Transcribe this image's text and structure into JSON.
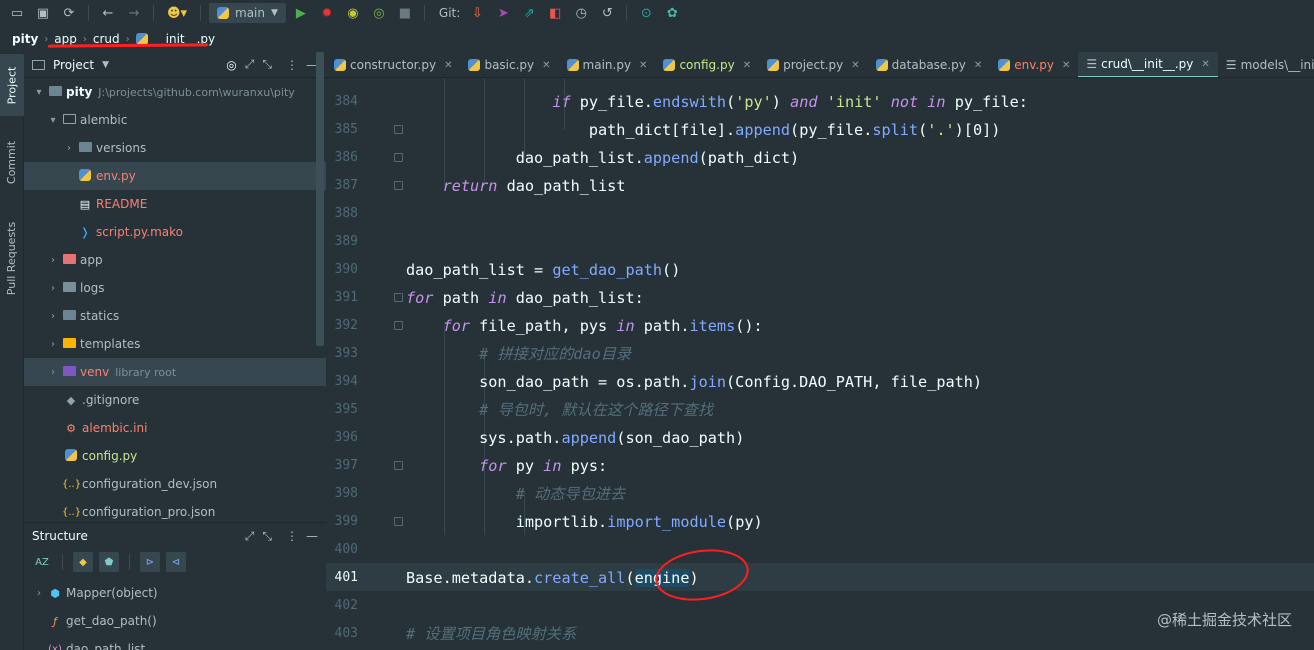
{
  "toolbar": {
    "branch": "main",
    "git_label": "Git:"
  },
  "navbar": {
    "items": [
      "pity",
      "app",
      "crud",
      "__init__.py"
    ]
  },
  "left_tabs": [
    "Project",
    "Commit",
    "Pull Requests"
  ],
  "project_panel": {
    "title": "Project",
    "tree": [
      {
        "label": "pity",
        "hint": "J:\\projects\\github.com\\wuranxu\\pity",
        "kind": "root"
      },
      {
        "label": "alembic",
        "kind": "folder"
      },
      {
        "label": "versions",
        "kind": "folder"
      },
      {
        "label": "env.py",
        "kind": "py"
      },
      {
        "label": "README",
        "kind": "text"
      },
      {
        "label": "script.py.mako",
        "kind": "mako"
      },
      {
        "label": "app",
        "kind": "folder"
      },
      {
        "label": "logs",
        "kind": "folder"
      },
      {
        "label": "statics",
        "kind": "folder"
      },
      {
        "label": "templates",
        "kind": "folder"
      },
      {
        "label": "venv",
        "hint": "library root",
        "kind": "venv"
      },
      {
        "label": ".gitignore",
        "kind": "git"
      },
      {
        "label": "alembic.ini",
        "kind": "ini"
      },
      {
        "label": "config.py",
        "kind": "py"
      },
      {
        "label": "configuration_dev.json",
        "kind": "json"
      },
      {
        "label": "configuration_pro.json",
        "kind": "json"
      }
    ]
  },
  "structure_panel": {
    "title": "Structure",
    "items": [
      {
        "label": "Mapper(object)",
        "icon": "class-icon"
      },
      {
        "label": "get_dao_path()",
        "icon": "function-icon"
      },
      {
        "label": "dao_path_list",
        "icon": "variable-icon"
      }
    ]
  },
  "tabs": [
    {
      "label": "constructor.py"
    },
    {
      "label": "basic.py"
    },
    {
      "label": "main.py"
    },
    {
      "label": "config.py"
    },
    {
      "label": "project.py"
    },
    {
      "label": "database.py"
    },
    {
      "label": "env.py"
    },
    {
      "label": "crud\\__init__.py"
    },
    {
      "label": "models\\__init__"
    }
  ],
  "editor": {
    "line_numbers": [
      "384",
      "385",
      "386",
      "387",
      "388",
      "389",
      "390",
      "391",
      "392",
      "393",
      "394",
      "395",
      "396",
      "397",
      "398",
      "399",
      "400",
      "401",
      "402",
      "403"
    ],
    "current_line": "401",
    "lines": [
      [
        {
          "t": "                ",
          "c": ""
        },
        {
          "t": "if",
          "c": "kw"
        },
        {
          "t": " py_file.",
          "c": ""
        },
        {
          "t": "endswith",
          "c": "fn"
        },
        {
          "t": "(",
          "c": ""
        },
        {
          "t": "'py'",
          "c": "st"
        },
        {
          "t": ") ",
          "c": ""
        },
        {
          "t": "and",
          "c": "kw"
        },
        {
          "t": " ",
          "c": ""
        },
        {
          "t": "'init'",
          "c": "st"
        },
        {
          "t": " ",
          "c": ""
        },
        {
          "t": "not in",
          "c": "kw"
        },
        {
          "t": " py_file:",
          "c": ""
        }
      ],
      [
        {
          "t": "                    path_dict[file].",
          "c": ""
        },
        {
          "t": "append",
          "c": "fn"
        },
        {
          "t": "(py_file.",
          "c": ""
        },
        {
          "t": "split",
          "c": "fn"
        },
        {
          "t": "(",
          "c": ""
        },
        {
          "t": "'.'",
          "c": "st"
        },
        {
          "t": ")[0])",
          "c": ""
        }
      ],
      [
        {
          "t": "            dao_path_list.",
          "c": ""
        },
        {
          "t": "append",
          "c": "fn"
        },
        {
          "t": "(path_dict)",
          "c": ""
        }
      ],
      [
        {
          "t": "    ",
          "c": ""
        },
        {
          "t": "return",
          "c": "kw"
        },
        {
          "t": " dao_path_list",
          "c": ""
        }
      ],
      [],
      [],
      [
        {
          "t": "dao_path_list = ",
          "c": ""
        },
        {
          "t": "get_dao_path",
          "c": "fn"
        },
        {
          "t": "()",
          "c": ""
        }
      ],
      [
        {
          "t": "for",
          "c": "kw"
        },
        {
          "t": " path ",
          "c": ""
        },
        {
          "t": "in",
          "c": "kw"
        },
        {
          "t": " dao_path_list:",
          "c": ""
        }
      ],
      [
        {
          "t": "    ",
          "c": ""
        },
        {
          "t": "for",
          "c": "kw"
        },
        {
          "t": " file_path, pys ",
          "c": ""
        },
        {
          "t": "in",
          "c": "kw"
        },
        {
          "t": " path.",
          "c": ""
        },
        {
          "t": "items",
          "c": "fn"
        },
        {
          "t": "():",
          "c": ""
        }
      ],
      [
        {
          "t": "        ",
          "c": ""
        },
        {
          "t": "# 拼接对应的dao目录",
          "c": "cm"
        }
      ],
      [
        {
          "t": "        son_dao_path = os.path.",
          "c": ""
        },
        {
          "t": "join",
          "c": "fn"
        },
        {
          "t": "(Config.DAO_PATH, file_path)",
          "c": ""
        }
      ],
      [
        {
          "t": "        ",
          "c": ""
        },
        {
          "t": "# 导包时, 默认在这个路径下查找",
          "c": "cm"
        }
      ],
      [
        {
          "t": "        sys.path.",
          "c": ""
        },
        {
          "t": "append",
          "c": "fn"
        },
        {
          "t": "(son_dao_path)",
          "c": ""
        }
      ],
      [
        {
          "t": "        ",
          "c": ""
        },
        {
          "t": "for",
          "c": "kw"
        },
        {
          "t": " py ",
          "c": ""
        },
        {
          "t": "in",
          "c": "kw"
        },
        {
          "t": " pys:",
          "c": ""
        }
      ],
      [
        {
          "t": "            ",
          "c": ""
        },
        {
          "t": "# 动态导包进去",
          "c": "cm"
        }
      ],
      [
        {
          "t": "            importlib.",
          "c": ""
        },
        {
          "t": "import_module",
          "c": "fn"
        },
        {
          "t": "(py)",
          "c": ""
        }
      ],
      [],
      [
        {
          "t": "Base.metadata.",
          "c": ""
        },
        {
          "t": "create_all",
          "c": "fn"
        },
        {
          "t": "(",
          "c": ""
        },
        {
          "t": "engine",
          "c": "hl"
        },
        {
          "t": ")",
          "c": ""
        }
      ],
      [],
      [
        {
          "t": "# 设置项目角色映射关系",
          "c": "cm"
        }
      ]
    ]
  },
  "watermark": "@稀土掘金技术社区",
  "colors": {
    "background": "#263238",
    "keyword": "#c792ea",
    "function": "#82aaff",
    "string": "#c3e88d",
    "comment": "#546e7a",
    "accent": "#80cbc4",
    "annotation": "#ff1f1f"
  }
}
